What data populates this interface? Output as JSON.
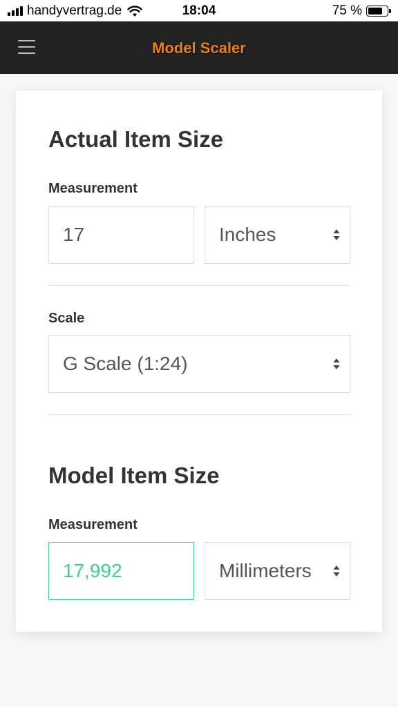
{
  "status_bar": {
    "carrier": "handyvertrag.de",
    "time": "18:04",
    "battery_percent": "75 %",
    "battery_level": 0.75
  },
  "navbar": {
    "title": "Model Scaler",
    "title_color": "#e8801c",
    "menu_icon": "hamburger-menu-icon"
  },
  "actual": {
    "heading": "Actual Item Size",
    "measurement_label": "Measurement",
    "value": "17",
    "unit": "Inches",
    "scale_label": "Scale",
    "scale": "G Scale (1:24)"
  },
  "model": {
    "heading": "Model Item Size",
    "measurement_label": "Measurement",
    "value": "17,992",
    "unit": "Millimeters",
    "value_color": "#3ecf8e"
  }
}
